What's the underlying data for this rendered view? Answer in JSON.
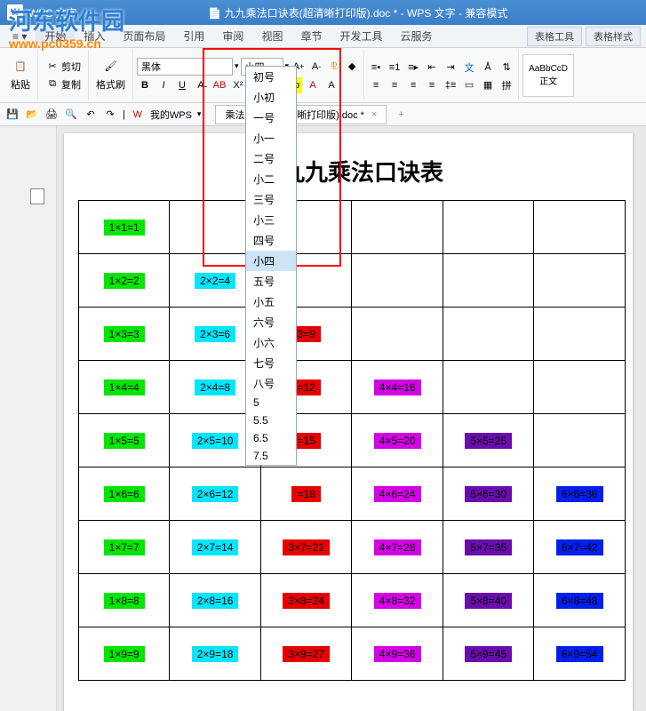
{
  "app": {
    "name": "WPS 文字",
    "doc_icon": "📄",
    "title_doc": "九九乘法口诀表(超清晰打印版).doc *",
    "suffix": "- WPS 文字 - 兼容模式"
  },
  "watermark": {
    "line1": "河东软件园",
    "line2": "www.pc0359.cn"
  },
  "menu": {
    "items": [
      "开始",
      "插入",
      "页面布局",
      "引用",
      "审阅",
      "视图",
      "章节",
      "开发工具",
      "云服务"
    ],
    "tool_tabs": [
      "表格工具",
      "表格样式"
    ]
  },
  "ribbon": {
    "paste": "粘贴",
    "cut": "剪切",
    "copy": "复制",
    "format_painter": "格式刷",
    "font_name": "黑体",
    "font_size": "小四",
    "bold": "B",
    "italic": "I",
    "underline": "U",
    "strike": "A",
    "style_preview": "AaBbCcD",
    "style_name": "正文"
  },
  "qat": {
    "mywps": "我的WPS",
    "doc_tab": "乘法口诀表(超清晰打印版).doc *"
  },
  "doc": {
    "title": "九九乘法口诀表",
    "rows": [
      [
        {
          "t": "1×1=1",
          "c": 1
        }
      ],
      [
        {
          "t": "1×2=2",
          "c": 1
        },
        {
          "t": "2×2=4",
          "c": 2
        }
      ],
      [
        {
          "t": "1×3=3",
          "c": 1
        },
        {
          "t": "2×3=6",
          "c": 2
        },
        {
          "t": "3=9",
          "c": 3
        }
      ],
      [
        {
          "t": "1×4=4",
          "c": 1
        },
        {
          "t": "2×4=8",
          "c": 2
        },
        {
          "t": "=12",
          "c": 3
        },
        {
          "t": "4×4=16",
          "c": 4
        }
      ],
      [
        {
          "t": "1×5=5",
          "c": 1
        },
        {
          "t": "2×5=10",
          "c": 2
        },
        {
          "t": "=15",
          "c": 3
        },
        {
          "t": "4×5=20",
          "c": 4
        },
        {
          "t": "5×5=25",
          "c": 5
        }
      ],
      [
        {
          "t": "1×6=6",
          "c": 1
        },
        {
          "t": "2×6=12",
          "c": 2
        },
        {
          "t": "=18",
          "c": 3
        },
        {
          "t": "4×6=24",
          "c": 4
        },
        {
          "t": "5×6=30",
          "c": 5
        },
        {
          "t": "6×6=36",
          "c": 6
        }
      ],
      [
        {
          "t": "1×7=7",
          "c": 1
        },
        {
          "t": "2×7=14",
          "c": 2
        },
        {
          "t": "3×7=21",
          "c": 3
        },
        {
          "t": "4×7=28",
          "c": 4
        },
        {
          "t": "5×7=35",
          "c": 5
        },
        {
          "t": "6×7=42",
          "c": 6
        }
      ],
      [
        {
          "t": "1×8=8",
          "c": 1
        },
        {
          "t": "2×8=16",
          "c": 2
        },
        {
          "t": "3×8=24",
          "c": 3
        },
        {
          "t": "4×8=32",
          "c": 4
        },
        {
          "t": "5×8=40",
          "c": 5
        },
        {
          "t": "6×8=48",
          "c": 6
        }
      ],
      [
        {
          "t": "1×9=9",
          "c": 1
        },
        {
          "t": "2×9=18",
          "c": 2
        },
        {
          "t": "3×9=27",
          "c": 3
        },
        {
          "t": "4×9=36",
          "c": 4
        },
        {
          "t": "5×9=45",
          "c": 5
        },
        {
          "t": "6×9=54",
          "c": 6
        }
      ]
    ]
  },
  "size_options": [
    "初号",
    "小初",
    "一号",
    "小一",
    "二号",
    "小二",
    "三号",
    "小三",
    "四号",
    "小四",
    "五号",
    "小五",
    "六号",
    "小六",
    "七号",
    "八号",
    "5",
    "5.5",
    "6.5",
    "7.5"
  ],
  "size_selected": "小四"
}
